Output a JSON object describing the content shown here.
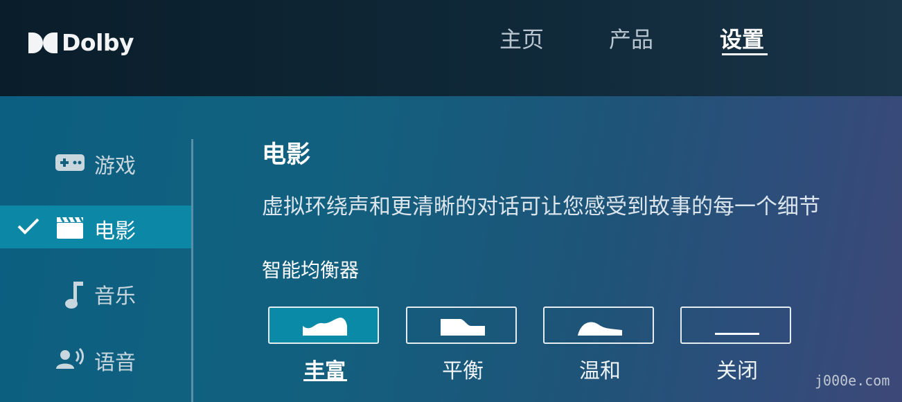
{
  "brand": {
    "name": "Dolby"
  },
  "nav": {
    "items": [
      "主页",
      "产品",
      "设置"
    ],
    "active_index": 2
  },
  "sidebar": {
    "items": [
      {
        "label": "游戏",
        "icon": "gamepad-icon",
        "selected": false
      },
      {
        "label": "电影",
        "icon": "clapperboard-icon",
        "selected": true
      },
      {
        "label": "音乐",
        "icon": "music-note-icon",
        "selected": false
      },
      {
        "label": "语音",
        "icon": "voice-icon",
        "selected": false
      }
    ]
  },
  "content": {
    "title": "电影",
    "description": "虚拟环绕声和更清晰的对话可让您感受到故事的每一个细节",
    "equalizer_label": "智能均衡器",
    "equalizer_options": [
      {
        "label": "丰富",
        "icon": "eq-rich-icon",
        "selected": true
      },
      {
        "label": "平衡",
        "icon": "eq-balanced-icon",
        "selected": false
      },
      {
        "label": "温和",
        "icon": "eq-warm-icon",
        "selected": false
      },
      {
        "label": "关闭",
        "icon": "eq-off-icon",
        "selected": false
      }
    ]
  },
  "watermark": "j000e.com",
  "colors": {
    "selected_bg": "#0d87a6",
    "header_bg": "#0a1d2a",
    "text": "#ffffff"
  }
}
